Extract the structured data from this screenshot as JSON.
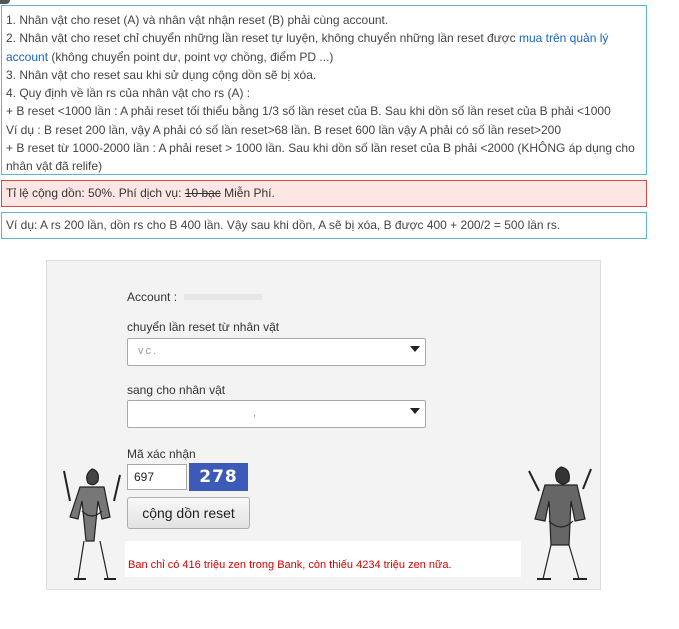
{
  "rules": {
    "line1": "1. Nhân vật cho reset (A) và nhân vật nhận reset (B) phải cùng account.",
    "line2_prefix": "2. Nhân vật cho reset chỉ chuyển những lần reset tự luyện, không chuyển những lần reset được ",
    "line2_link": "mua trên quản lý account",
    "line2_suffix": " (không chuyển point dư, point vợ chồng, điểm PD ...)",
    "line3": "3. Nhân vật cho reset sau khi sử dụng cộng dồn sẽ bị xóa.",
    "line4": "4. Quy định về lần rs của nhân vật cho rs (A) :",
    "line5": "+ B reset <1000 lần : A phải reset tối thiểu bằng 1/3 số lần reset của B. Sau khi dồn số lần reset của B phải <1000",
    "line6": "Ví dụ : B reset 200 lần, vậy A phải có số lần reset>68 lần. B reset 600 lần vậy A phải có số lần reset>200",
    "line7": "+ B reset từ 1000-2000 lần : A phải reset > 1000 lần. Sau khi dồn số lần reset của B phải <2000 (KHÔNG áp dụng cho nhân vật đã relife)"
  },
  "rate": {
    "prefix": "Tỉ lệ cộng dồn: 50%. Phí dịch vụ: ",
    "old_fee": "10 bạc",
    "free": " Miễn Phí."
  },
  "example": "Ví dụ: A rs 200 lần, dồn rs cho B 400 lần. Vậy sau khi dồn, A sẽ bị xóa, B được 400 + 200/2 = 500 lần rs.",
  "form": {
    "account_label": "Account :",
    "from_label": "chuyển lần reset từ nhân vật",
    "from_value": "vc.",
    "to_label": "sang cho nhân vật",
    "to_value": ",",
    "captcha_label": "Mã xác nhận",
    "captcha_value": "697",
    "captcha_image_text": "278",
    "submit_label": "cộng dồn reset",
    "message": "Ban chỉ có 416 triệu zen trong Bank, còn thiếu 4234 triệu zen nữa."
  },
  "colors": {
    "info_border": "#5fb4d6",
    "warn_border": "#d64a4a",
    "warn_bg": "#fde6e3",
    "link": "#1565c0",
    "error_text": "#d40000",
    "captcha_bg": "#3c5ab8"
  }
}
